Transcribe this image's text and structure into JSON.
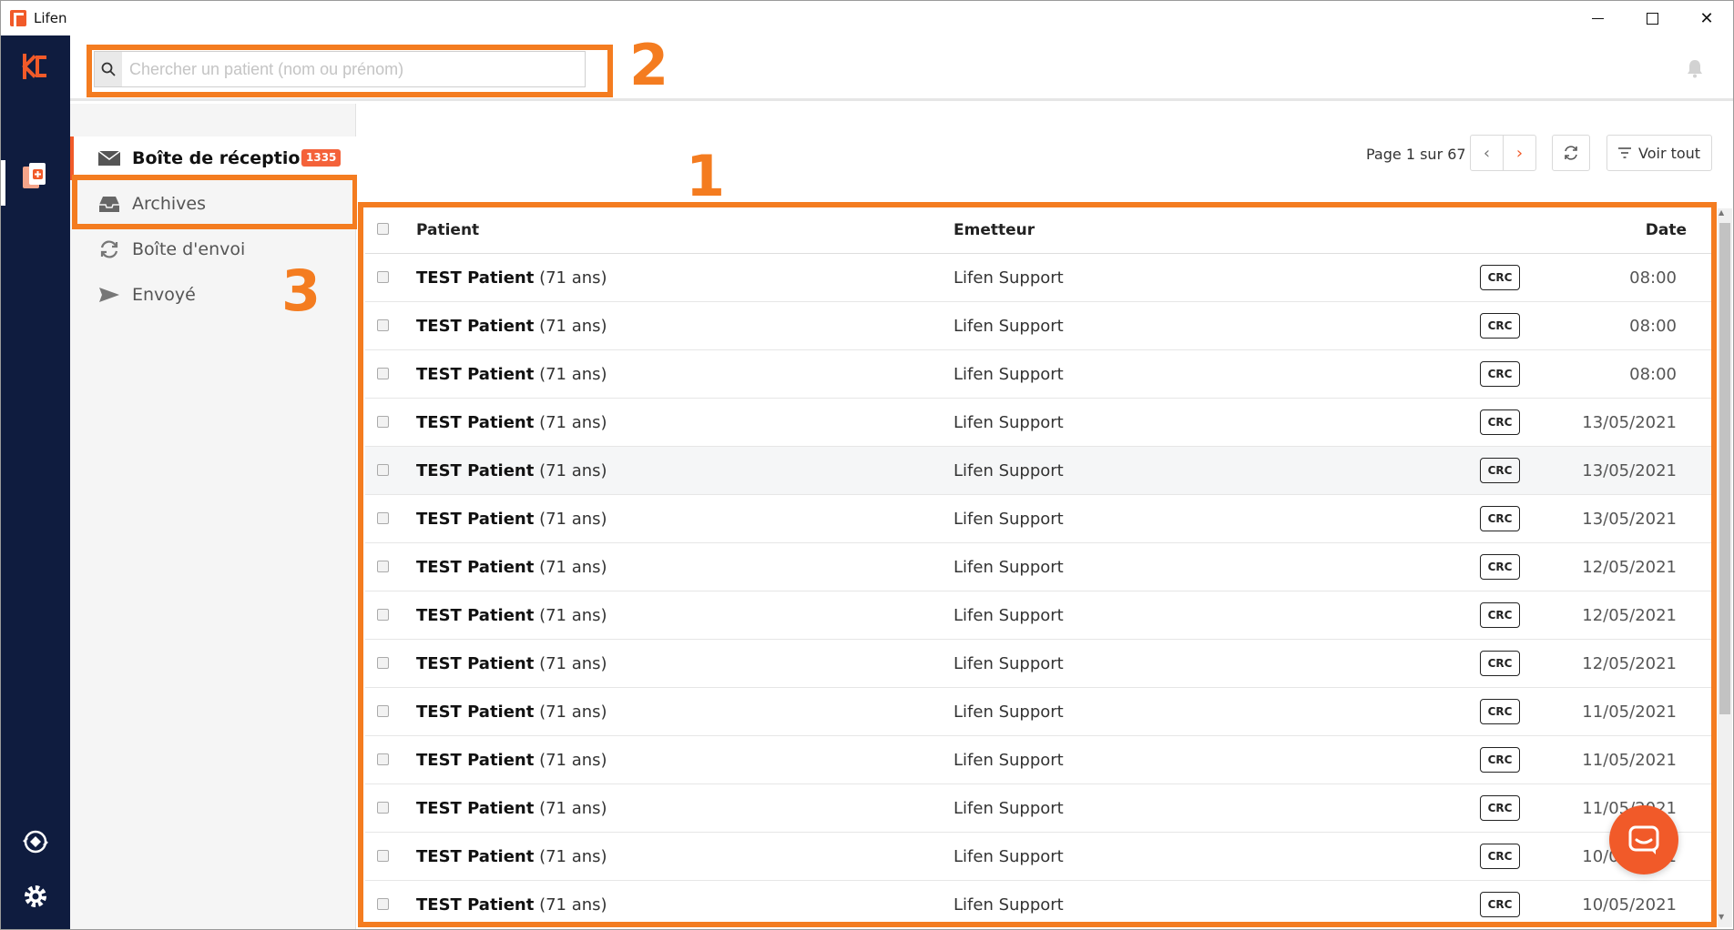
{
  "window": {
    "title": "Lifen",
    "controls": {
      "minimize": "minimize",
      "maximize": "maximize",
      "close": "✕"
    }
  },
  "rail": {
    "items": [
      "lifen-logo-icon",
      "documents-icon",
      "sync-icon",
      "settings-icon"
    ],
    "accent": "#f15a29",
    "background": "#0f1c3f"
  },
  "search": {
    "placeholder": "Chercher un patient (nom ou prénom)",
    "value": ""
  },
  "annotations": {
    "table": "1",
    "search": "2",
    "folders": "3",
    "color": "#f47c20"
  },
  "folders": [
    {
      "label": "Boîte de réception",
      "badge": "1335",
      "icon": "envelope-icon",
      "active": true
    },
    {
      "label": "Archives",
      "icon": "inbox-tray-icon",
      "active": false
    },
    {
      "label": "Boîte d'envoi",
      "icon": "sync-arrows-icon",
      "active": false
    },
    {
      "label": "Envoyé",
      "icon": "paper-plane-icon",
      "active": false
    }
  ],
  "pagination": {
    "text": "Page 1 sur 67",
    "prev": "‹",
    "next": "›"
  },
  "toolbar": {
    "voir_tout": "Voir tout"
  },
  "table": {
    "headers": {
      "patient": "Patient",
      "emetteur": "Emetteur",
      "date": "Date"
    },
    "rows": [
      {
        "name": "TEST Patient",
        "age": "(71 ans)",
        "sender": "Lifen Support",
        "tag": "CRC",
        "date": "08:00"
      },
      {
        "name": "TEST Patient",
        "age": "(71 ans)",
        "sender": "Lifen Support",
        "tag": "CRC",
        "date": "08:00"
      },
      {
        "name": "TEST Patient",
        "age": "(71 ans)",
        "sender": "Lifen Support",
        "tag": "CRC",
        "date": "08:00"
      },
      {
        "name": "TEST Patient",
        "age": "(71 ans)",
        "sender": "Lifen Support",
        "tag": "CRC",
        "date": "13/05/2021"
      },
      {
        "name": "TEST Patient",
        "age": "(71 ans)",
        "sender": "Lifen Support",
        "tag": "CRC",
        "date": "13/05/2021"
      },
      {
        "name": "TEST Patient",
        "age": "(71 ans)",
        "sender": "Lifen Support",
        "tag": "CRC",
        "date": "13/05/2021"
      },
      {
        "name": "TEST Patient",
        "age": "(71 ans)",
        "sender": "Lifen Support",
        "tag": "CRC",
        "date": "12/05/2021"
      },
      {
        "name": "TEST Patient",
        "age": "(71 ans)",
        "sender": "Lifen Support",
        "tag": "CRC",
        "date": "12/05/2021"
      },
      {
        "name": "TEST Patient",
        "age": "(71 ans)",
        "sender": "Lifen Support",
        "tag": "CRC",
        "date": "12/05/2021"
      },
      {
        "name": "TEST Patient",
        "age": "(71 ans)",
        "sender": "Lifen Support",
        "tag": "CRC",
        "date": "11/05/2021"
      },
      {
        "name": "TEST Patient",
        "age": "(71 ans)",
        "sender": "Lifen Support",
        "tag": "CRC",
        "date": "11/05/2021"
      },
      {
        "name": "TEST Patient",
        "age": "(71 ans)",
        "sender": "Lifen Support",
        "tag": "CRC",
        "date": "11/05/2021"
      },
      {
        "name": "TEST Patient",
        "age": "(71 ans)",
        "sender": "Lifen Support",
        "tag": "CRC",
        "date": "10/05/2021"
      },
      {
        "name": "TEST Patient",
        "age": "(71 ans)",
        "sender": "Lifen Support",
        "tag": "CRC",
        "date": "10/05/2021"
      }
    ]
  }
}
